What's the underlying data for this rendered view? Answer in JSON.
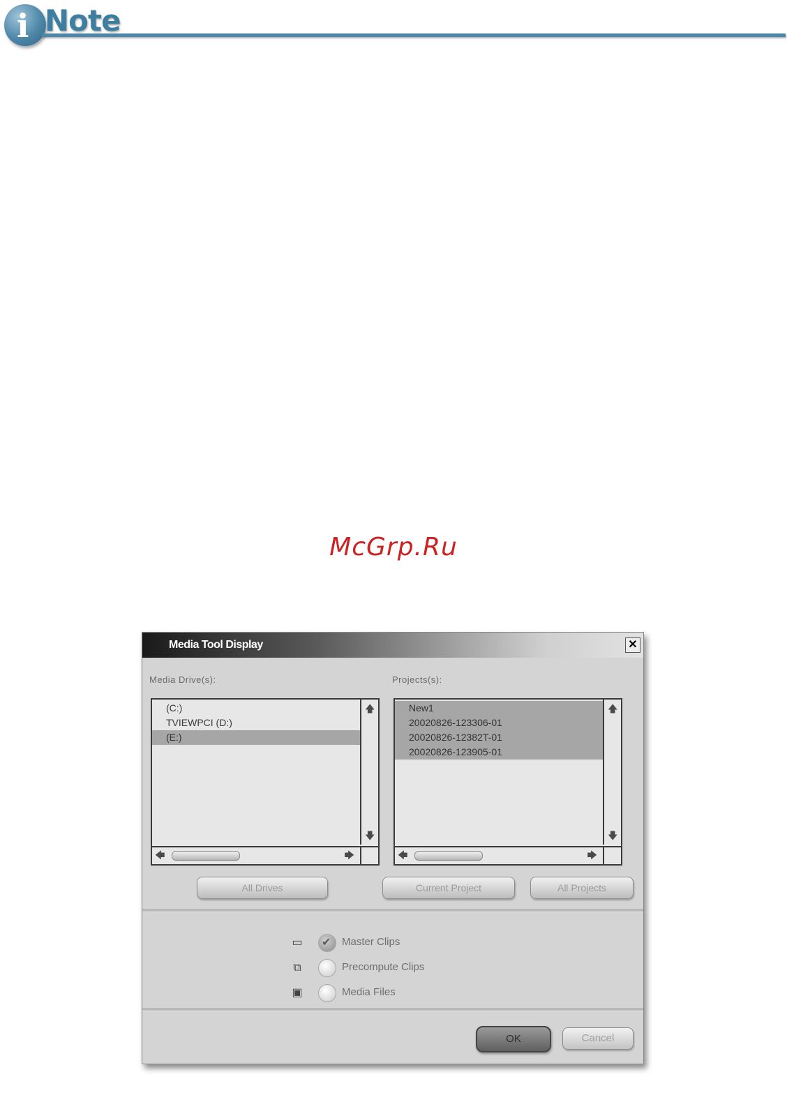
{
  "header": {
    "logo_letter": "i",
    "logo_text": "Note"
  },
  "watermark": "McGrp.Ru",
  "dialog": {
    "title": "Media Tool Display",
    "close_glyph": "✕",
    "media_drives": {
      "label": "Media Drive(s):",
      "items": [
        {
          "text": "(C:)",
          "selected": false
        },
        {
          "text": "TVIEWPCI (D:)",
          "selected": false
        },
        {
          "text": "(E:)",
          "selected": true
        }
      ]
    },
    "projects": {
      "label": "Projects(s):",
      "items": [
        {
          "text": "New1",
          "selected": true
        },
        {
          "text": "20020826-123306-01",
          "selected": true
        },
        {
          "text": "20020826-12382T-01",
          "selected": true
        },
        {
          "text": "20020826-123905-01",
          "selected": true
        }
      ]
    },
    "buttons": {
      "all_drives": "All Drives",
      "current_project": "Current Project",
      "all_projects": "All Projects",
      "ok": "OK",
      "cancel": "Cancel"
    },
    "options": [
      {
        "label": "Master Clips",
        "icon": "film-strip-icon",
        "glyph": "▭",
        "checked": true
      },
      {
        "label": "Precompute Clips",
        "icon": "precompute-icon",
        "glyph": "⧉",
        "checked": false
      },
      {
        "label": "Media Files",
        "icon": "media-file-icon",
        "glyph": "▣",
        "checked": false
      }
    ]
  },
  "colors": {
    "note_blue": "#3e7ea1",
    "watermark_red": "#cc2222",
    "dialog_bg": "#d4d4d4",
    "selection": "#a6a6a6"
  }
}
